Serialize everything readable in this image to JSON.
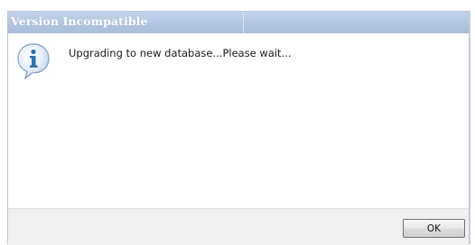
{
  "dialog": {
    "title": "Version Incompatible",
    "message": "Upgrading to new database...Please wait...",
    "icon": "info-icon",
    "ok_label": "OK"
  },
  "colors": {
    "titlebar": "#b1c4e0",
    "title_text": "#ffffff",
    "footer": "#f0f0f0",
    "icon_blue": "#2f6fb3"
  }
}
